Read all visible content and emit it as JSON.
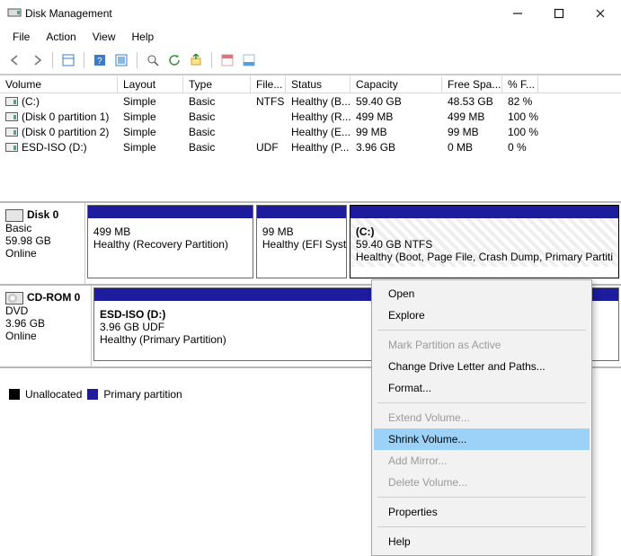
{
  "window": {
    "title": "Disk Management"
  },
  "menus": {
    "file": "File",
    "action": "Action",
    "view": "View",
    "help": "Help"
  },
  "columns": {
    "volume": "Volume",
    "layout": "Layout",
    "type": "Type",
    "fs": "File...",
    "status": "Status",
    "capacity": "Capacity",
    "free": "Free Spa...",
    "pctfree": "% F..."
  },
  "volumes": [
    {
      "name": "(C:)",
      "layout": "Simple",
      "type": "Basic",
      "fs": "NTFS",
      "status": "Healthy (B...",
      "capacity": "59.40 GB",
      "free": "48.53 GB",
      "pctfree": "82 %"
    },
    {
      "name": "(Disk 0 partition 1)",
      "layout": "Simple",
      "type": "Basic",
      "fs": "",
      "status": "Healthy (R...",
      "capacity": "499 MB",
      "free": "499 MB",
      "pctfree": "100 %"
    },
    {
      "name": "(Disk 0 partition 2)",
      "layout": "Simple",
      "type": "Basic",
      "fs": "",
      "status": "Healthy (E...",
      "capacity": "99 MB",
      "free": "99 MB",
      "pctfree": "100 %"
    },
    {
      "name": "ESD-ISO (D:)",
      "layout": "Simple",
      "type": "Basic",
      "fs": "UDF",
      "status": "Healthy (P...",
      "capacity": "3.96 GB",
      "free": "0 MB",
      "pctfree": "0 %"
    }
  ],
  "disk0": {
    "name": "Disk 0",
    "type": "Basic",
    "size": "59.98 GB",
    "state": "Online",
    "p1_size": "499 MB",
    "p1_status": "Healthy (Recovery Partition)",
    "p2_size": "99 MB",
    "p2_status": "Healthy (EFI System",
    "p3_name": "(C:)",
    "p3_size": "59.40 GB NTFS",
    "p3_status": "Healthy (Boot, Page File, Crash Dump, Primary Partiti"
  },
  "cdrom": {
    "name": "CD-ROM 0",
    "type": "DVD",
    "size": "3.96 GB",
    "state": "Online",
    "p_name": "ESD-ISO  (D:)",
    "p_size": "3.96 GB UDF",
    "p_status": "Healthy (Primary Partition)"
  },
  "legend": {
    "unallocated": "Unallocated",
    "primary": "Primary partition"
  },
  "context": {
    "open": "Open",
    "explore": "Explore",
    "mark_active": "Mark Partition as Active",
    "change_letter": "Change Drive Letter and Paths...",
    "format": "Format...",
    "extend": "Extend Volume...",
    "shrink": "Shrink Volume...",
    "add_mirror": "Add Mirror...",
    "delete": "Delete Volume...",
    "properties": "Properties",
    "help": "Help"
  }
}
